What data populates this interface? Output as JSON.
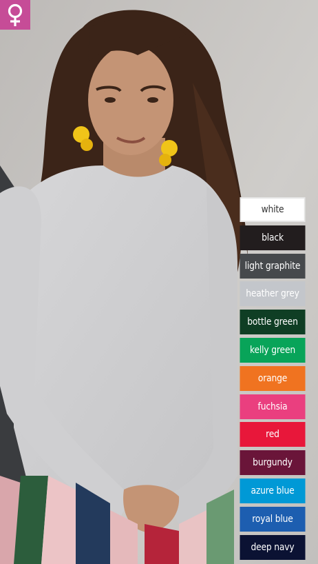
{
  "badge": {
    "icon": "female-symbol-icon",
    "color": "#c64c97"
  },
  "colors": [
    {
      "name": "white",
      "hex": "#ffffff"
    },
    {
      "name": "black",
      "hex": "#221d1e"
    },
    {
      "name": "light graphite",
      "hex": "#46494c"
    },
    {
      "name": "heather grey",
      "hex": "#c3c6cb"
    },
    {
      "name": "bottle green",
      "hex": "#0f3e24"
    },
    {
      "name": "kelly green",
      "hex": "#08a459"
    },
    {
      "name": "orange",
      "hex": "#f07320"
    },
    {
      "name": "fuchsia",
      "hex": "#ea3f7f"
    },
    {
      "name": "red",
      "hex": "#e8173a"
    },
    {
      "name": "burgundy",
      "hex": "#6a1539"
    },
    {
      "name": "azure blue",
      "hex": "#0099d6"
    },
    {
      "name": "royal blue",
      "hex": "#1d5eb0"
    },
    {
      "name": "deep navy",
      "hex": "#0b1233"
    }
  ]
}
